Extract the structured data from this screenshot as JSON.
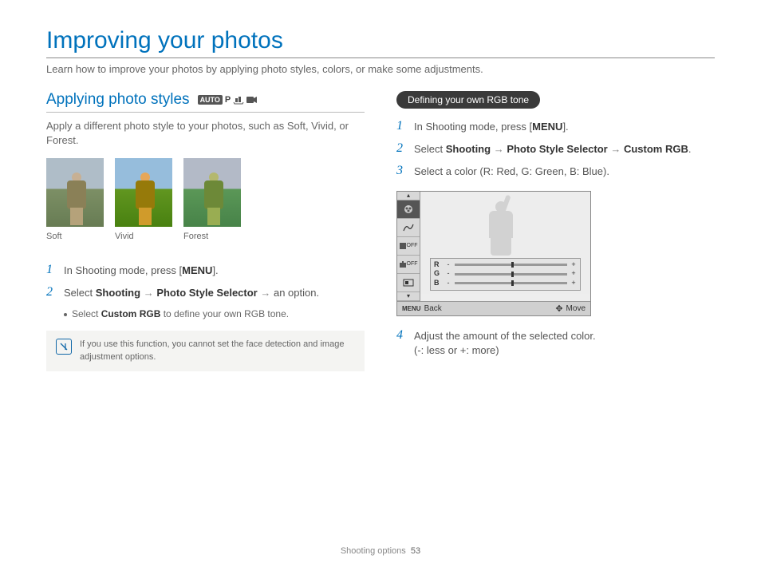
{
  "title": "Improving your photos",
  "intro": "Learn how to improve your photos by applying photo styles, colors, or make some adjustments.",
  "left": {
    "heading": "Applying photo styles",
    "modes": {
      "auto": "AUTO",
      "p": "P",
      "dis": "DIS",
      "video": "video-icon"
    },
    "desc": "Apply a different photo style to your photos, such as Soft, Vivid, or Forest.",
    "thumbs": [
      {
        "label": "Soft"
      },
      {
        "label": "Vivid"
      },
      {
        "label": "Forest"
      }
    ],
    "step1_pre": "In Shooting mode, press [",
    "step1_btn": "MENU",
    "step1_post": "].",
    "step2_pre": "Select ",
    "step2_b1": "Shooting",
    "step2_arr": " → ",
    "step2_b2": "Photo Style Selector",
    "step2_post": " → an option.",
    "substep_pre": "Select ",
    "substep_b": "Custom RGB",
    "substep_post": " to define your own RGB tone.",
    "note": "If you use this function, you cannot set the face detection and image adjustment options."
  },
  "right": {
    "pill": "Defining your own RGB tone",
    "step1_pre": "In Shooting mode, press [",
    "step1_btn": "MENU",
    "step1_post": "].",
    "step2_pre": "Select ",
    "step2_b1": "Shooting",
    "step2_arr": " → ",
    "step2_b2": "Photo Style Selector",
    "step2_arr2": " → ",
    "step2_b3": "Custom RGB",
    "step2_post": ".",
    "step3": "Select a color (R: Red, G: Green, B: Blue).",
    "lcd": {
      "side_off1": "OFF",
      "side_off2": "OFF",
      "r": "R",
      "g": "G",
      "b": "B",
      "back_label": "Back",
      "back_btn": "MENU",
      "move_label": "Move"
    },
    "step4_a": "Adjust the amount of the selected color.",
    "step4_b": "(-: less or +: more)"
  },
  "footer": {
    "section": "Shooting options",
    "page": "53"
  }
}
